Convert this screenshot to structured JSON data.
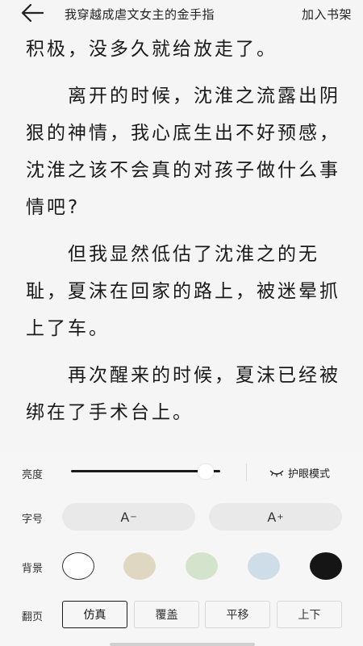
{
  "header": {
    "back_icon": "arrow-left-icon",
    "title": "我穿越成虐文女主的金手指",
    "add_to_shelf": "加入书架"
  },
  "content": {
    "paragraphs": [
      "积极，没多久就给放走了。",
      "　　离开的时候，沈淮之流露出阴狠的神情，我心底生出不好预感，沈淮之该不会真的对孩子做什么事情吧?",
      "　　但我显然低估了沈淮之的无耻，夏沫在回家的路上，被迷晕抓上了车。",
      "　　再次醒来的时候，夏沫已经被绑在了手术台上。"
    ]
  },
  "settings": {
    "brightness": {
      "label": "亮度",
      "level": 0.9
    },
    "eye_care": {
      "icon": "eye-closed-icon",
      "label": "护眼模式"
    },
    "font_size": {
      "label": "字号",
      "decrease": {
        "base": "A",
        "mark": "−"
      },
      "increase": {
        "base": "A",
        "mark": "+"
      }
    },
    "background": {
      "label": "背景",
      "colors": [
        "#ffffff",
        "#e0d7c3",
        "#d4e4cc",
        "#cfdde8",
        "#151515"
      ],
      "selected_index": 0
    },
    "page_flip": {
      "label": "翻页",
      "options": [
        "仿真",
        "覆盖",
        "平移",
        "上下"
      ],
      "selected_index": 0
    }
  }
}
